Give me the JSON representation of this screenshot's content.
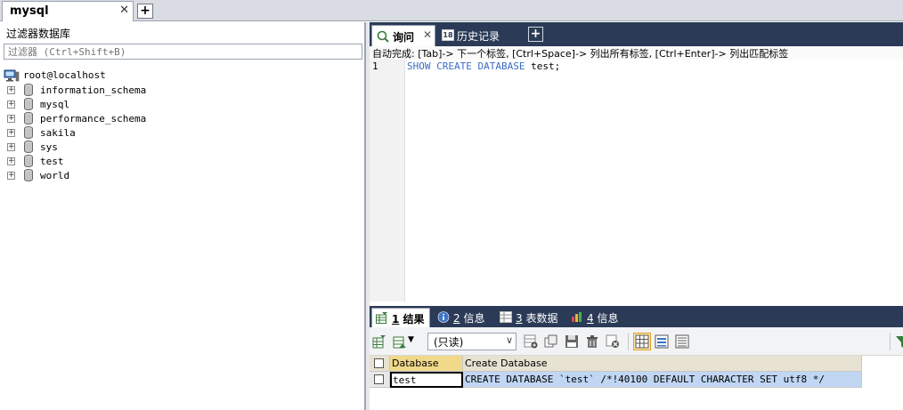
{
  "connection_tab": {
    "label": "mysql",
    "close": "✕",
    "new": "+"
  },
  "left": {
    "filter_title": "过滤器数据库",
    "filter_placeholder": "过滤器 (Ctrl+Shift+B)",
    "root": "root@localhost",
    "databases": [
      {
        "name": "information_schema"
      },
      {
        "name": "mysql"
      },
      {
        "name": "performance_schema"
      },
      {
        "name": "sakila"
      },
      {
        "name": "sys"
      },
      {
        "name": "test"
      },
      {
        "name": "world"
      }
    ]
  },
  "editor_tabs": {
    "query": "询问",
    "close": "✕",
    "history": "历史记录",
    "history_icon_text": "18",
    "new": "+"
  },
  "hint": "自动完成: [Tab]-> 下一个标签, [Ctrl+Space]-> 列出所有标签, [Ctrl+Enter]-> 列出匹配标签",
  "editor": {
    "line_number": "1",
    "kw1": "SHOW",
    "kw2": "CREATE",
    "kw3": "DATABASE",
    "arg": "test;"
  },
  "result_tabs": [
    {
      "num": "1",
      "label": "结果"
    },
    {
      "num": "2",
      "label": "信息"
    },
    {
      "num": "3",
      "label": "表数据"
    },
    {
      "num": "4",
      "label": "信息"
    }
  ],
  "toolbar": {
    "readonly": "(只读)",
    "dropdown_arrow": "∨"
  },
  "grid": {
    "columns": [
      "Database",
      "Create Database"
    ],
    "rows": [
      {
        "database": "test",
        "create": "CREATE DATABASE `test` /*!40100 DEFAULT CHARACTER SET utf8 */"
      }
    ]
  },
  "colors": {
    "dark_header": "#2b3b57",
    "keyword": "#3c6dc4",
    "selected_row": "#c0d6f3",
    "grid_header": "#e7e2d2"
  }
}
